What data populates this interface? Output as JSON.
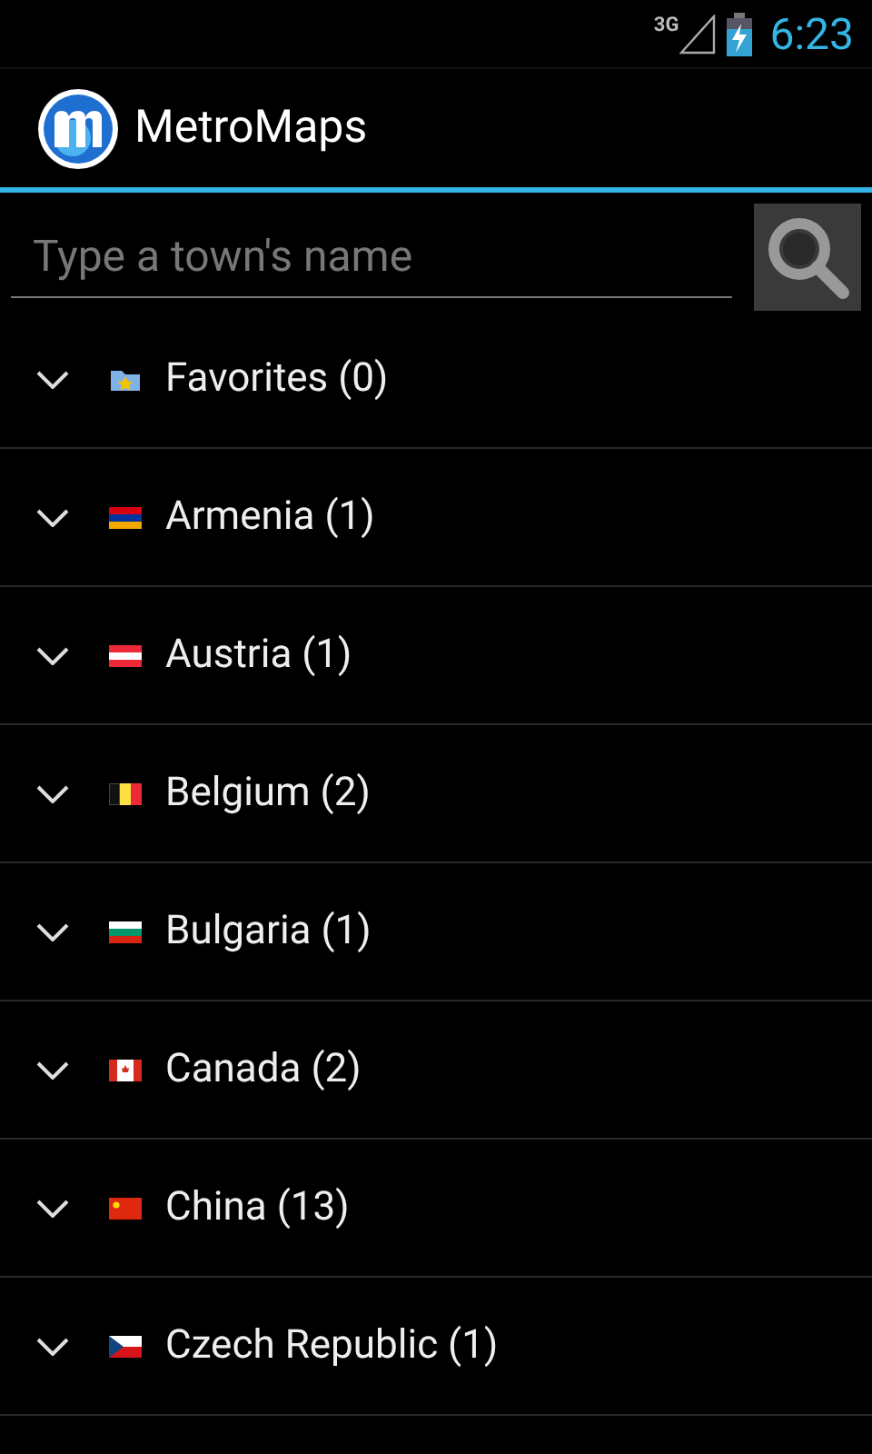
{
  "status_bar": {
    "network": "3G",
    "time": "6:23"
  },
  "app_bar": {
    "title": "MetroMaps"
  },
  "search": {
    "placeholder": "Type a town's name"
  },
  "groups": [
    {
      "label": "Favorites (0)",
      "kind": "favorites",
      "expanded": false
    },
    {
      "label": "Armenia (1)",
      "kind": "armenia",
      "expanded": false
    },
    {
      "label": "Austria (1)",
      "kind": "austria",
      "expanded": false
    },
    {
      "label": "Belgium (2)",
      "kind": "belgium",
      "expanded": false
    },
    {
      "label": "Bulgaria (1)",
      "kind": "bulgaria",
      "expanded": false
    },
    {
      "label": "Canada (2)",
      "kind": "canada",
      "expanded": false
    },
    {
      "label": "China (13)",
      "kind": "china",
      "expanded": false
    },
    {
      "label": "Czech Republic (1)",
      "kind": "czech",
      "expanded": false
    }
  ]
}
